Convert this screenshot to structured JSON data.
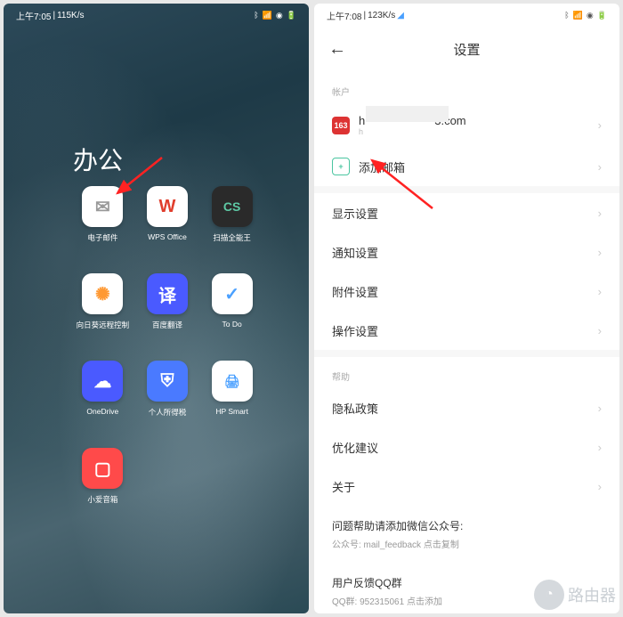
{
  "left": {
    "status": {
      "time": "上午7:05",
      "speed": "115K/s"
    },
    "folder_title": "办公",
    "apps": [
      {
        "name": "电子邮件",
        "bg": "#ffffff",
        "fg": "#999",
        "glyph": "✉"
      },
      {
        "name": "WPS Office",
        "bg": "#ffffff",
        "fg": "#e03e2d",
        "glyph": "W"
      },
      {
        "name": "扫描全能王",
        "bg": "#2a2a2a",
        "fg": "#5ec9a5",
        "glyph": "CS"
      },
      {
        "name": "向日葵远程控制",
        "bg": "#ffffff",
        "fg": "#ff9933",
        "glyph": "✺"
      },
      {
        "name": "百度翻译",
        "bg": "#4a5aff",
        "fg": "#fff",
        "glyph": "译"
      },
      {
        "name": "To Do",
        "bg": "#ffffff",
        "fg": "#4aa0ff",
        "glyph": "✓"
      },
      {
        "name": "OneDrive",
        "bg": "#4a5aff",
        "fg": "#fff",
        "glyph": "☁"
      },
      {
        "name": "个人所得税",
        "bg": "#4a7aff",
        "fg": "#fff",
        "glyph": "⛨"
      },
      {
        "name": "HP Smart",
        "bg": "#ffffff",
        "fg": "#4aa0ff",
        "glyph": "🖨"
      },
      {
        "name": "小爱音箱",
        "bg": "#ff4a4a",
        "fg": "#fff",
        "glyph": "▢"
      }
    ]
  },
  "right": {
    "status": {
      "time": "上午7:08",
      "speed": "123K/s"
    },
    "header_title": "设置",
    "sections": {
      "account_label": "帐户",
      "account": {
        "text": "h",
        "text_end": "3.com",
        "sub": "h",
        "icon_bg": "#d33",
        "icon_fg": "#fff",
        "icon_text": "163"
      },
      "add_mailbox": "添加邮箱",
      "settings_items": [
        "显示设置",
        "通知设置",
        "附件设置",
        "操作设置"
      ],
      "help_label": "帮助",
      "help_items": [
        "隐私政策",
        "优化建议",
        "关于"
      ],
      "wechat": {
        "title": "问题帮助请添加微信公众号:",
        "sub": "公众号: mail_feedback 点击复制"
      },
      "qq": {
        "title": "用户反馈QQ群",
        "sub": "QQ群: 952315061 点击添加"
      }
    }
  },
  "watermark": "路由器"
}
